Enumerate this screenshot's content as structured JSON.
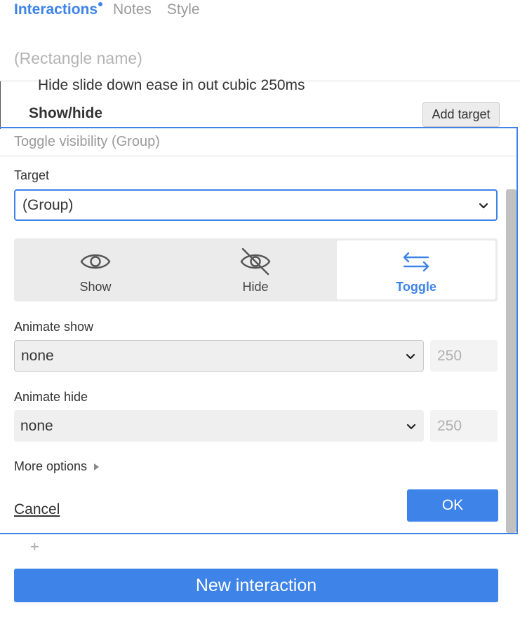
{
  "tabs": [
    {
      "label": "Interactions",
      "active": true,
      "has_dot": true
    },
    {
      "label": "Notes",
      "active": false
    },
    {
      "label": "Style",
      "active": false
    }
  ],
  "name_field": {
    "placeholder": "(Rectangle name)"
  },
  "history": {
    "line": "Hide slide down ease in out cubic 250ms",
    "title": "Show/hide",
    "add_target_label": "Add target"
  },
  "panel": {
    "title": "Toggle visibility (Group)",
    "target_label": "Target",
    "target_value": "(Group)",
    "modes": [
      {
        "label": "Show",
        "icon": "eye-icon",
        "active": false
      },
      {
        "label": "Hide",
        "icon": "eye-off-icon",
        "active": false
      },
      {
        "label": "Toggle",
        "icon": "swap-arrows-icon",
        "active": true
      }
    ],
    "animate_show": {
      "label": "Animate show",
      "value": "none",
      "duration_placeholder": "250"
    },
    "animate_hide": {
      "label": "Animate hide",
      "value": "none",
      "duration_placeholder": "250"
    },
    "more_options_label": "More options",
    "cancel_label": "Cancel",
    "ok_label": "OK"
  },
  "footer": {
    "plus_label": "+",
    "new_interaction_label": "New interaction"
  },
  "colors": {
    "accent": "#3d83e8",
    "muted": "#9a9a9a"
  }
}
